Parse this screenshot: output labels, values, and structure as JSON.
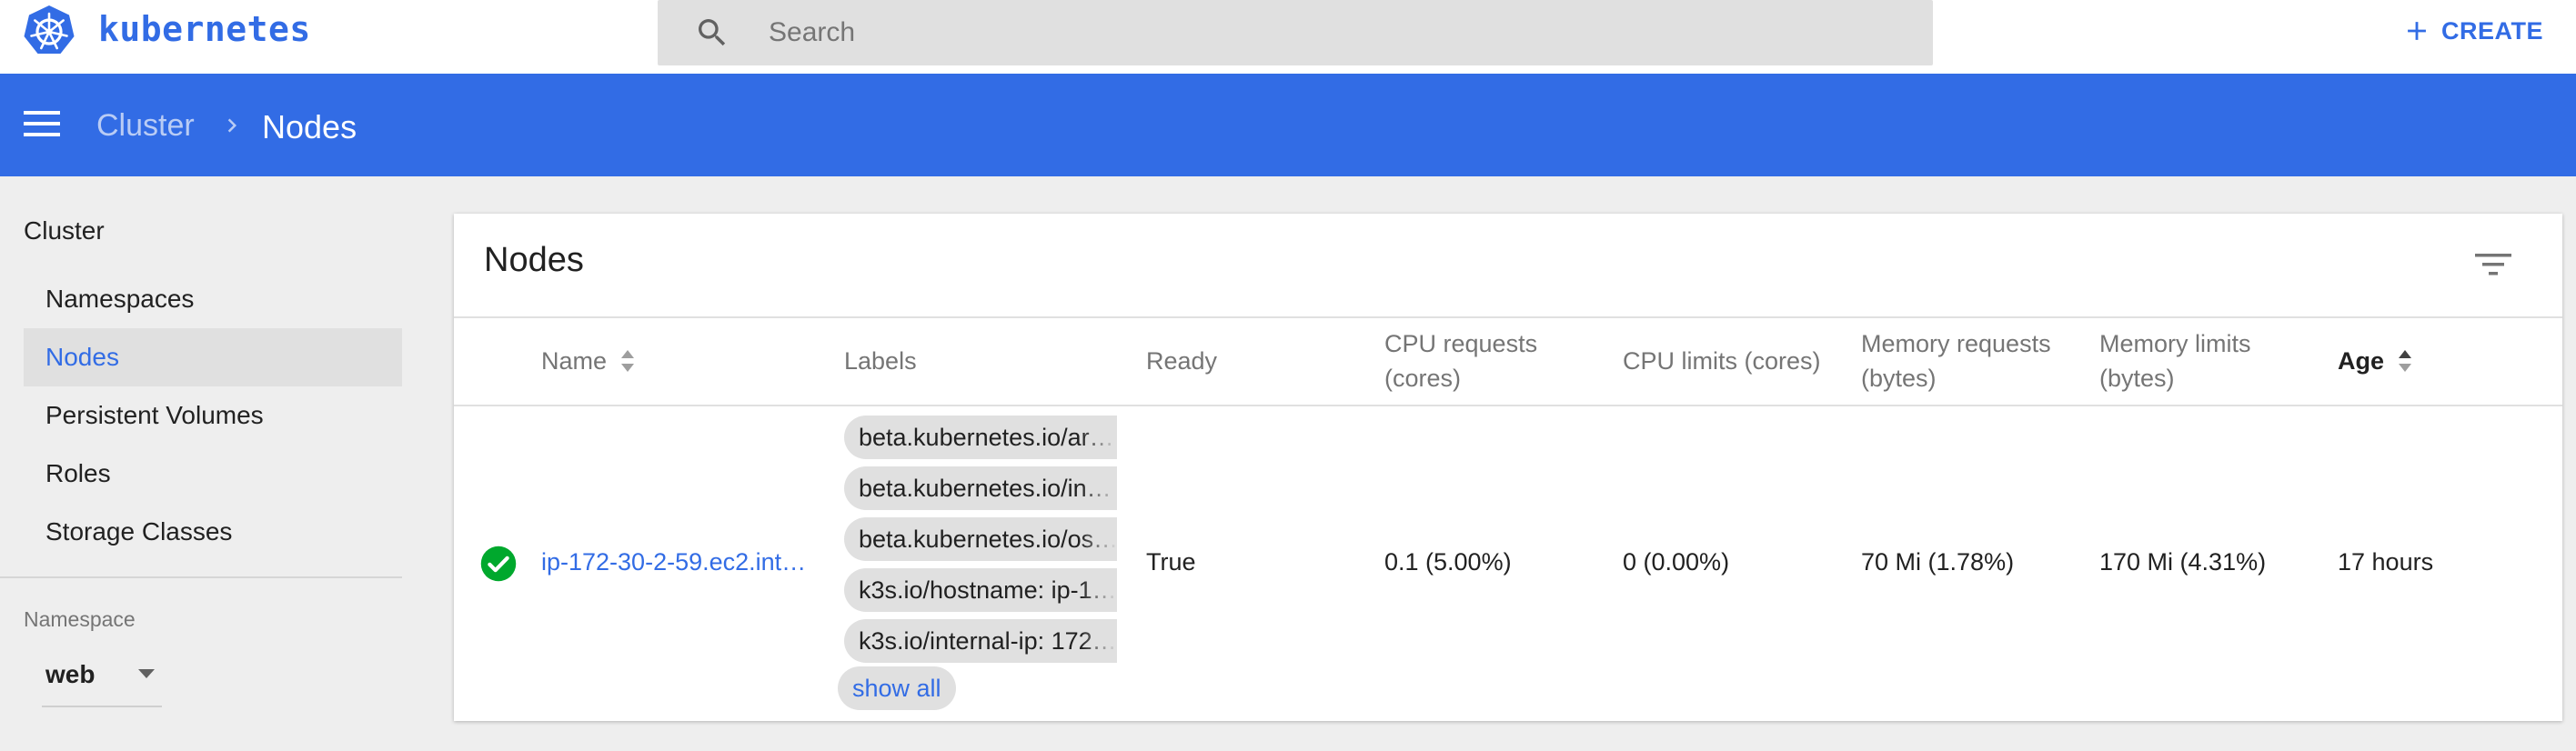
{
  "topbar": {
    "brand": "kubernetes",
    "search_placeholder": "Search",
    "create_label": "CREATE"
  },
  "header": {
    "breadcrumb_parent": "Cluster",
    "breadcrumb_current": "Nodes"
  },
  "sidebar": {
    "section_title": "Cluster",
    "items": [
      {
        "label": "Namespaces",
        "active": false
      },
      {
        "label": "Nodes",
        "active": true
      },
      {
        "label": "Persistent Volumes",
        "active": false
      },
      {
        "label": "Roles",
        "active": false
      },
      {
        "label": "Storage Classes",
        "active": false
      }
    ],
    "namespace_label": "Namespace",
    "namespace_value": "web"
  },
  "card": {
    "title": "Nodes",
    "columns": {
      "name": "Name",
      "labels": "Labels",
      "ready": "Ready",
      "cpu_requests_1": "CPU requests",
      "cpu_requests_2": "(cores)",
      "cpu_limits": "CPU limits (cores)",
      "mem_requests_1": "Memory requests",
      "mem_requests_2": "(bytes)",
      "mem_limits_1": "Memory limits",
      "mem_limits_2": "(bytes)",
      "age": "Age"
    },
    "rows": [
      {
        "status": "ready",
        "name": "ip-172-30-2-59.ec2.int…",
        "labels": [
          "beta.kubernetes.io/ar…",
          "beta.kubernetes.io/in…",
          "beta.kubernetes.io/os…",
          "k3s.io/hostname: ip-1…",
          "k3s.io/internal-ip: 172…"
        ],
        "show_all": "show all",
        "ready": "True",
        "cpu_requests": "0.1 (5.00%)",
        "cpu_limits": "0 (0.00%)",
        "mem_requests": "70 Mi (1.78%)",
        "mem_limits": "170 Mi (4.31%)",
        "age": "17 hours"
      }
    ]
  },
  "colors": {
    "brand": "#326ce5",
    "success": "#00a82d"
  }
}
